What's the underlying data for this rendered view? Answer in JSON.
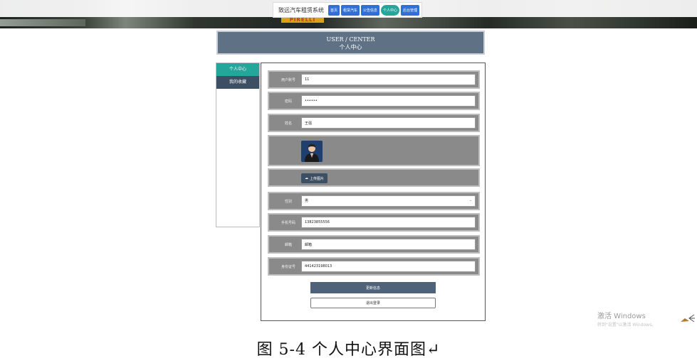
{
  "nav": {
    "brand": "致远汽车租赁系统",
    "items": [
      "首页",
      "租赁汽车",
      "公告信息",
      "个人中心",
      "后台管理"
    ],
    "active_index": 3
  },
  "banner": {
    "stripe_text": "PIRELLI"
  },
  "header": {
    "title_en": "USER / CENTER",
    "title_cn": "个人中心"
  },
  "sidebar": {
    "items": [
      {
        "label": "个人中心",
        "active": true
      },
      {
        "label": "我的收藏",
        "active": false
      }
    ]
  },
  "form": {
    "fields": [
      {
        "label": "用户账号",
        "value": "11"
      },
      {
        "label": "密码",
        "value": "••••••"
      },
      {
        "label": "姓名",
        "value": "王强"
      }
    ],
    "upload_label": "上传图片",
    "gender": {
      "label": "性别",
      "value": "男"
    },
    "fields2": [
      {
        "label": "手机号码",
        "value": "13823855556"
      },
      {
        "label": "邮箱",
        "value": "邮箱"
      },
      {
        "label": "身份证号",
        "value": "441423198013"
      }
    ],
    "update_button": "更新信息",
    "logout_button": "退出登录"
  },
  "watermark": {
    "line1": "激活 Windows",
    "line2": "转到\"设置\"以激活 Windows。"
  },
  "caption": "图 5-4 个人中心界面图↵",
  "colors": {
    "nav_blue": "#2f6fd6",
    "active_teal": "#26a69a",
    "header_slate": "#5f7185",
    "sidebar_dark": "#3c4f63",
    "row_gray": "#8a8a8a"
  }
}
